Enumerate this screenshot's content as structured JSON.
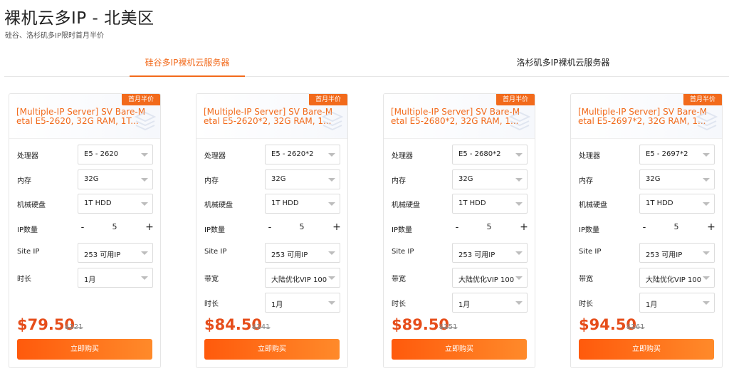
{
  "page": {
    "title": "裸机云多IP - 北美区",
    "subtitle": "硅谷、洛杉矶多IP限时首月半价"
  },
  "tabs": [
    {
      "label": "硅谷多IP裸机云服务器",
      "active": true
    },
    {
      "label": "洛杉矶多IP裸机云服务器",
      "active": false
    }
  ],
  "colors": {
    "accent": "#f26a1b",
    "price": "#e64d1a"
  },
  "labels": {
    "cpu": "处理器",
    "ram": "内存",
    "disk": "机械硬盘",
    "ip_count": "IP数量",
    "site_ip": "Site IP",
    "bandwidth": "带宽",
    "duration": "时长",
    "minus": "-",
    "plus": "+",
    "buy": "立即购买",
    "badge": "首月半价"
  },
  "cards": [
    {
      "title": "[Multiple-IP Server] SV Bare-Metal E5-2620, 32G RAM, 1T...",
      "cpu": "E5 - 2620",
      "ram": "32G",
      "disk": "1T HDD",
      "ip_count": "5",
      "site_ip": "253 可用IP",
      "duration": "1月",
      "price": "$79.50",
      "old_price": "$221"
    },
    {
      "title": "[Multiple-IP Server] SV Bare-Metal E5-2620*2, 32G RAM, 1...",
      "cpu": "E5 - 2620*2",
      "ram": "32G",
      "disk": "1T HDD",
      "ip_count": "5",
      "site_ip": "253 可用IP",
      "bandwidth": "大陆优化VIP 100",
      "duration": "1月",
      "price": "$84.50",
      "old_price": "$241"
    },
    {
      "title": "[Multiple-IP Server] SV Bare-Metal E5-2680*2, 32G RAM, 1...",
      "cpu": "E5 - 2680*2",
      "ram": "32G",
      "disk": "1T HDD",
      "ip_count": "5",
      "site_ip": "253 可用IP",
      "bandwidth": "大陆优化VIP 100",
      "duration": "1月",
      "price": "$89.50",
      "old_price": "$251"
    },
    {
      "title": "[Multiple-IP Server] SV Bare-Metal E5-2697*2, 32G RAM, 1...",
      "cpu": "E5 - 2697*2",
      "ram": "32G",
      "disk": "1T HDD",
      "ip_count": "5",
      "site_ip": "253 可用IP",
      "bandwidth": "大陆优化VIP 100",
      "duration": "1月",
      "price": "$94.50",
      "old_price": "$261"
    }
  ]
}
